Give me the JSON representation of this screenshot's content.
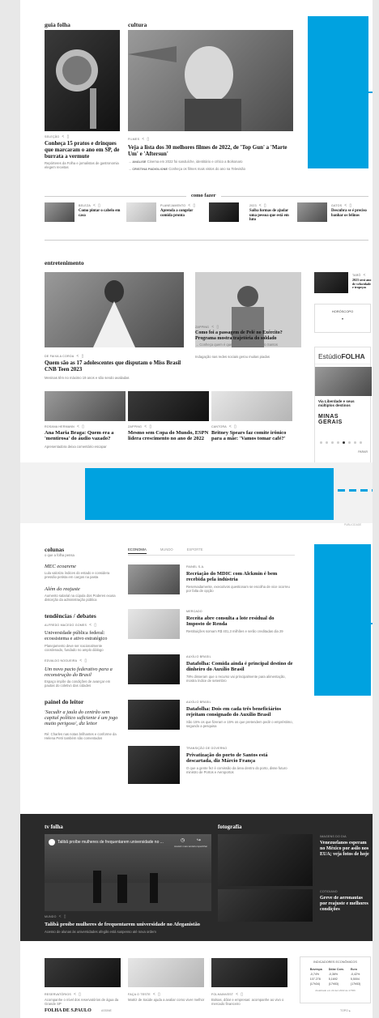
{
  "guia": {
    "title": "guia folha",
    "kicker": "Seleção",
    "headline": "Conheça 15 pratos e drinques que marcaram o ano em SP, de burrata a vermute",
    "sub": "Repórteres da Folha e jornalistas de gastronomia elegem receitas"
  },
  "cultura": {
    "title": "cultura",
    "kicker": "Filmes",
    "headline": "Veja a lista dos 30 melhores filmes de 2022, de 'Top Gun' a 'Marte Um' e 'Aftersun'",
    "rel1_kicker": "Análise",
    "rel1": "Cinema em 2022 foi sanduíche, identitário e crítico a Bolsonaro",
    "rel2_kicker": "Cristina Padiglione",
    "rel2": "Conheça os filmes mais vistos do ano na Televisão"
  },
  "como_fazer": {
    "title": "como fazer",
    "items": [
      {
        "kicker": "Beleza",
        "headline": "Como pintar o cabelo em casa"
      },
      {
        "kicker": "Planejamento",
        "headline": "Aprenda a congelar comida pronta"
      },
      {
        "kicker": "2023",
        "headline": "Saiba formas de ajudar uma pessoa que está em luto"
      },
      {
        "kicker": "Gatos",
        "headline": "Descubra se é preciso banhar os felinos"
      }
    ]
  },
  "entretenimento": {
    "title": "entretenimento",
    "main_kicker": "De Faixa a Coroa",
    "main_headline": "Quem são as 17 adolescentes que disputam o Miss Brasil CNB Teen 2023",
    "main_sub": "Meninas têm no máximo 19 anos e são sendo avaliadas",
    "mid_kicker": "Zapping",
    "mid_headline": "Como foi a passagem de Pelé no Exército? Programa mostra trajetória do soldado",
    "mid_rel": "Conheça quem é quem na família do dez do Santos",
    "mid_sub": "Indagação nas redes sociais gerou muitas piadas",
    "side_kicker": "Tarô",
    "side_headline": "2023 será ano de velocidade e tropeços",
    "horoscopo": "Horóscopo",
    "estudio_a": "Estúdio",
    "estudio_b": "FOLHA",
    "ad_text": "Via Liberdade e seus múltiplos destinos",
    "minas_a": "MINAS",
    "minas_b": "GERAIS",
    "parar": "Parar",
    "row": [
      {
        "kicker": "Rosana Hermann",
        "headline": "Ana Maria Braga: Quem era a 'mentirosa' do áudio vazado?",
        "sub": "Apresentadora deixa comentário escapar"
      },
      {
        "kicker": "Zapping",
        "headline": "Mesmo sem Copa do Mundo, ESPN lidera crescimento no ano de 2022",
        "sub": ""
      },
      {
        "kicker": "Cantora",
        "headline": "Britney Spears faz comite irônico para a mãe: 'Vamos tomar café?'",
        "sub": ""
      }
    ]
  },
  "pub_label": "Publicidade",
  "colunas": {
    "title": "colunas",
    "sub": "o que a folha pensa",
    "e1_title": "MEC ecoarene",
    "e1_sub": "Lula valoriza índices do estado e considera pressão petista em cargos na pasta",
    "e2_title": "Além do reajuste",
    "e2_sub": "Aumento salarial na cúpula dos Poderes exusa distorção da administração pública",
    "debates": "tendências / debates",
    "d1_kicker": "Alfredo Macedo Gomes",
    "d1_title": "Universidade pública federal: ecossistema e ativo estratégico",
    "d1_sub": "Planejamento deve ser nacionalmente coordenado, fundado no amplo diálogo",
    "d2_kicker": "Edvaldo Nogueira",
    "d2_title": "Um novo pacto federativo para a reconstrução do Brasil",
    "d2_sub": "Espaço impõe da condições de avançar em pautas do coletivo das cidades",
    "painel": "painel do leitor",
    "p_title": "'Sacudir a jaula do centrão sem capital político suficiente é um jogo muito perigoso', diz leitor",
    "p_sub": "Ré: Charles nas notas brilhantes e conforme da Helena Petri também são comentados"
  },
  "economia": {
    "tabs": [
      "Economia",
      "Mundo",
      "Esporte"
    ],
    "items": [
      {
        "kicker": "Painel S.A.",
        "headline": "Recriação do MDIC com Alckmin é bem recebida pela indústria",
        "sub": "Reservadamente, executivos questionam se escolha de vice ocorreu por falta de opção"
      },
      {
        "kicker": "Mercado",
        "headline": "Receita abre consulta a lote residual do Imposto de Renda",
        "sub": "Restituições somam R$ 401,3 milhões e serão creditadas dia 29"
      },
      {
        "kicker": "Auxílio Brasil",
        "headline": "Datafolha: Comida ainda é principal destino de dinheiro do Auxílio Brasil",
        "sub": "78% disseram que o recurso vai principalmente para alimentação, mostra índice de setembro"
      },
      {
        "kicker": "Auxílio Brasil",
        "headline": "Datafolha: Dois em cada três beneficiários rejeitam consignado do Auxílio Brasil",
        "sub": "São 15% os que fizeram e 15% os que pretendem pedir o empréstimo, segundo a pesquisa"
      },
      {
        "kicker": "Transição de Governo",
        "headline": "Privatização do porto de Santos está descartada, diz Márcio França",
        "sub": "O que a gente fez é comissão da área dentro do porto, disse futuro ministro de Portos e Aeroportos"
      }
    ]
  },
  "tv": {
    "title": "tv folha",
    "video_title": "Talibã proíbe mulheres de frequentarem universidade no ...",
    "watch_later": "Assistir mais tarde",
    "share": "Compartilhar",
    "kicker": "Mundo",
    "headline": "Talibã proíbe mulheres de frequentarem universidade no Afeganistão",
    "sub": "Acesso de alunas às universidades afegãs está suspenso até nova ordem"
  },
  "foto": {
    "title": "fotografia",
    "i1_kicker": "Imagens do dia",
    "i1": "Venezuelanos esperam no México por asilo nos EUA; veja fotos de hoje",
    "i2_kicker": "Cotidiano",
    "i2": "Greve de aeronautas por reajuste e melhores condições"
  },
  "bottom": {
    "items": [
      {
        "kicker": "Reservatórios",
        "sub": "Acompanhe o nível dos reservatórios de água da Grande SP"
      },
      {
        "kicker": "Faça o teste",
        "sub": "Matriz de Saúde ajuda a avaliar como viver melhor"
      },
      {
        "kicker": "Folhainvest",
        "sub": "Bolsas, dólar e empresas: acompanhe ao vivo o mercado financeiro"
      }
    ],
    "ind_title": "Indicadores Econômicos",
    "ind_head": [
      "Bovespa",
      "Dólar Com.",
      "Euro"
    ],
    "ind_row1": [
      "-0,74%",
      "-0,36%",
      "-0,42%"
    ],
    "ind_row2": [
      "107.278",
      "5,1692",
      "5,5004"
    ],
    "ind_row3": [
      "(17h34)",
      "(17h53)",
      "(17h53)"
    ],
    "ind_note": "Atualizado em 22.dez.2022 às 17h56"
  },
  "footer": {
    "brand": "FOLHA DE S.PAULO",
    "link": "Assine",
    "top": "Topo"
  }
}
